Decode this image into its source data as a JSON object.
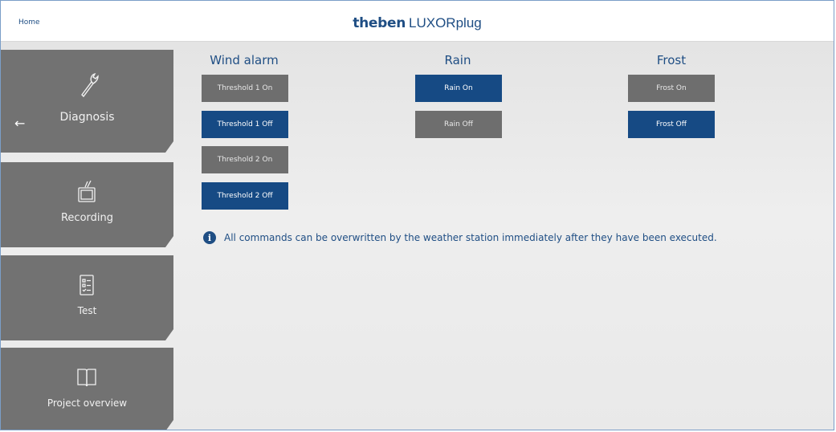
{
  "header": {
    "home_label": "Home",
    "brand_logo": "theben",
    "product_name": "LUXORplug"
  },
  "sidebar": {
    "items": [
      {
        "label": "Diagnosis",
        "icon": "wrench-icon"
      },
      {
        "label": "Recording",
        "icon": "tv-icon"
      },
      {
        "label": "Test",
        "icon": "checklist-icon"
      },
      {
        "label": "Project overview",
        "icon": "book-icon"
      }
    ],
    "back_icon": "left-arrow-icon"
  },
  "columns": {
    "wind": {
      "title": "Wind alarm",
      "buttons": [
        {
          "label": "Threshold 1 On",
          "active": false
        },
        {
          "label": "Threshold 1 Off",
          "active": true
        },
        {
          "label": "Threshold 2 On",
          "active": false
        },
        {
          "label": "Threshold 2 Off",
          "active": true
        }
      ]
    },
    "rain": {
      "title": "Rain",
      "buttons": [
        {
          "label": "Rain On",
          "active": true
        },
        {
          "label": "Rain Off",
          "active": false
        }
      ]
    },
    "frost": {
      "title": "Frost",
      "buttons": [
        {
          "label": "Frost On",
          "active": false
        },
        {
          "label": "Frost Off",
          "active": true
        }
      ]
    }
  },
  "info": {
    "icon": "info-icon",
    "text": "All commands can be overwritten by the weather station immediately after they have been executed."
  },
  "colors": {
    "brand_blue": "#1f4e84",
    "active_button": "#164a84",
    "inactive_button": "#6e6e6e",
    "sidebar_tile": "#727272"
  }
}
